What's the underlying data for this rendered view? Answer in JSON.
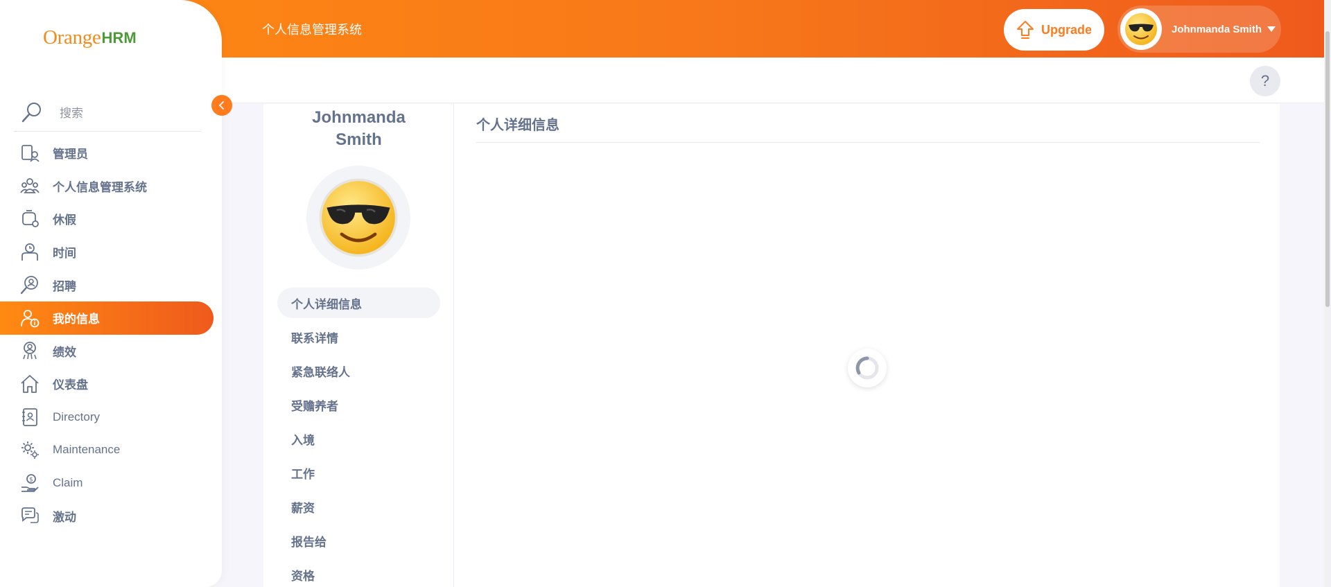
{
  "header": {
    "module_title": "个人信息管理系统",
    "upgrade_label": "Upgrade",
    "user_name": "Johnmanda Smith",
    "help_label": "?"
  },
  "sidebar": {
    "logo_orange": "Orange",
    "logo_hrm": "HRM",
    "search_placeholder": "搜索",
    "items": [
      {
        "label": "管理员",
        "icon": "admin-icon"
      },
      {
        "label": "个人信息管理系统",
        "icon": "pim-icon"
      },
      {
        "label": "休假",
        "icon": "leave-icon"
      },
      {
        "label": "时间",
        "icon": "time-icon"
      },
      {
        "label": "招聘",
        "icon": "recruitment-icon"
      },
      {
        "label": "我的信息",
        "icon": "my-info-icon",
        "active": true
      },
      {
        "label": "绩效",
        "icon": "performance-icon"
      },
      {
        "label": "仪表盘",
        "icon": "dashboard-icon"
      },
      {
        "label": "Directory",
        "icon": "directory-icon"
      },
      {
        "label": "Maintenance",
        "icon": "maintenance-icon"
      },
      {
        "label": "Claim",
        "icon": "claim-icon"
      },
      {
        "label": "激动",
        "icon": "buzz-icon"
      }
    ]
  },
  "profile": {
    "name_first": "Johnmanda",
    "name_last": "Smith",
    "tabs": [
      {
        "label": "个人详细信息",
        "active": true
      },
      {
        "label": "联系详情"
      },
      {
        "label": "紧急联络人"
      },
      {
        "label": "受赡养者"
      },
      {
        "label": "入境"
      },
      {
        "label": "工作"
      },
      {
        "label": "薪资"
      },
      {
        "label": "报告给"
      },
      {
        "label": "资格"
      }
    ]
  },
  "content": {
    "title": "个人详细信息"
  },
  "colors": {
    "accent": "#ff7b1d",
    "accent_dark": "#ef5a1c",
    "text": "#64728c",
    "brand_green": "#4e9a3a"
  }
}
